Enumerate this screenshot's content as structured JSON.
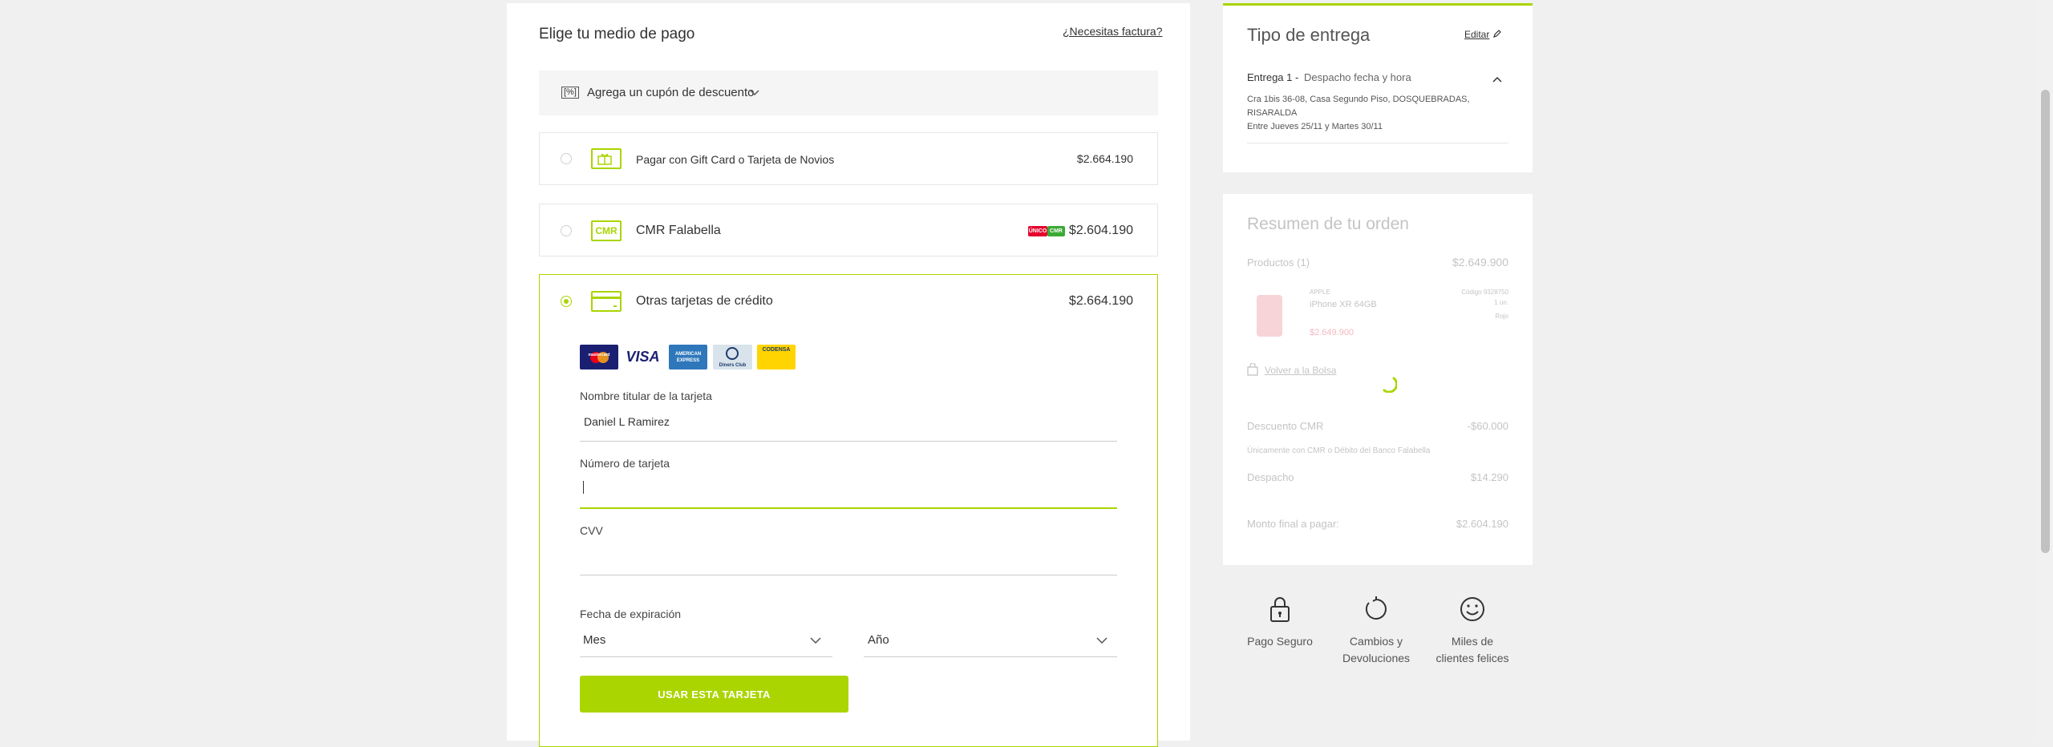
{
  "payment": {
    "title": "Elige tu medio de pago",
    "invoice_link": "¿Necesitas factura?",
    "coupon_icon": "[%]",
    "coupon_label": "Agrega un cupón de descuento",
    "options": [
      {
        "label": "Pagar con Gift Card o Tarjeta de Novios",
        "price": "$2.664.190",
        "icon": "gift-card-icon"
      },
      {
        "label": "CMR Falabella",
        "icon_text": "CMR",
        "price": "$2.604.190",
        "badges": [
          "ÚNICO",
          "CMR"
        ]
      },
      {
        "label": "Otras tarjetas de crédito",
        "price": "$2.664.190",
        "icon": "credit-card-icon"
      }
    ],
    "card_brands": [
      "mastercard",
      "VISA",
      "AMERICAN EXPRESS",
      "Diners Club",
      "CODENSA"
    ],
    "form": {
      "holder_label": "Nombre titular de la tarjeta",
      "holder_value": "Daniel L Ramirez",
      "number_label": "Número de tarjeta",
      "cvv_label": "CVV",
      "expiry_label": "Fecha de expiración",
      "month_value": "Mes",
      "year_value": "Año",
      "submit_label": "USAR ESTA TARJETA"
    }
  },
  "delivery": {
    "title": "Tipo de entrega",
    "edit_label": "Editar",
    "entry_label": "Entrega 1 -",
    "entry_type": "Despacho fecha y hora",
    "address_line1": "Cra 1bis 36-08, Casa Segundo Piso, DOSQUEBRADAS,",
    "address_line2": "RISARALDA",
    "dates": "Entre Jueves 25/11 y Martes 30/11"
  },
  "summary": {
    "title": "Resumen de tu orden",
    "products_label": "Productos (1)",
    "products_total": "$2.649.900",
    "product": {
      "brand": "APPLE",
      "name": "iPhone XR 64GB",
      "price": "$2.649.900",
      "code": "Código 9328750",
      "qty": "1 un.",
      "extra": "Rojo"
    },
    "back_link": "Volver a la Bolsa",
    "discount_label": "Descuento CMR",
    "discount_value": "-$60.000",
    "discount_note": "Únicamente con CMR o Débito del Banco Falabella",
    "shipping_label": "Despacho",
    "shipping_value": "$14.290",
    "final_label": "Monto final a pagar:",
    "final_value": "$2.604.190"
  },
  "trust": {
    "secure": "Pago Seguro",
    "returns_line1": "Cambios y",
    "returns_line2": "Devoluciones",
    "happy_line1": "Miles de",
    "happy_line2": "clientes felices"
  },
  "colors": {
    "accent": "#aad500",
    "background": "#f0f0f0",
    "panel": "#ffffff",
    "badge_red": "#e4002b",
    "badge_green": "#3aaa35"
  }
}
